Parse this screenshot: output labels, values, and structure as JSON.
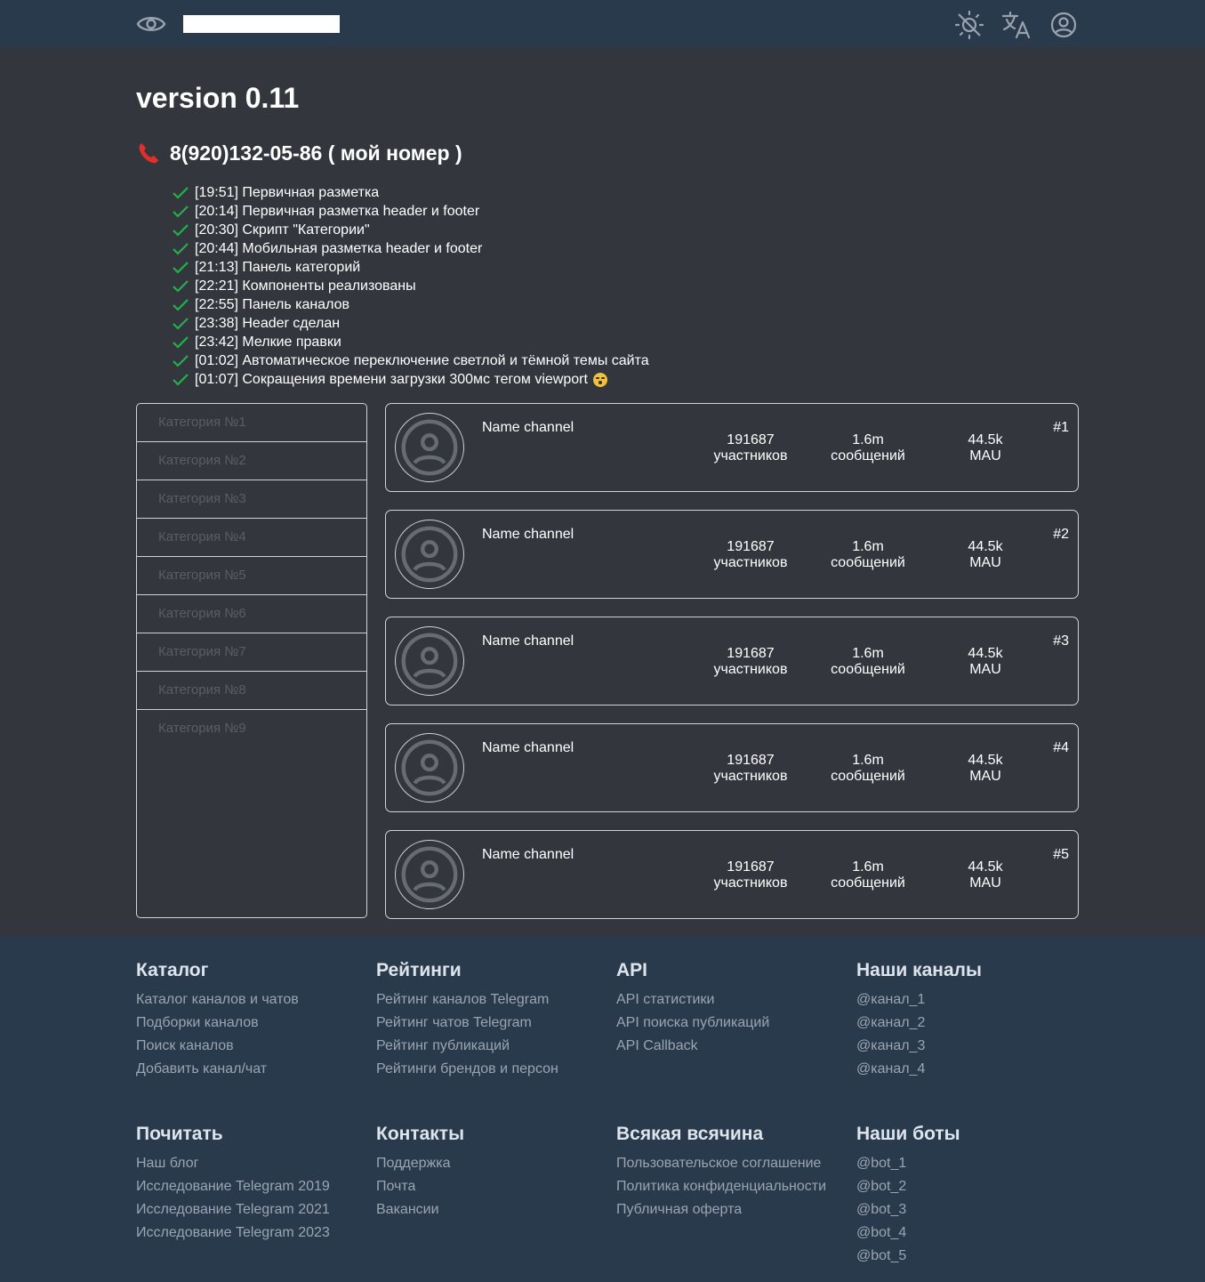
{
  "header": {
    "search_value": "",
    "icons": [
      "eye-icon",
      "theme-toggle-icon",
      "translate-icon",
      "account-icon"
    ]
  },
  "main": {
    "version": "version 0.11",
    "phone": "8(920)132-05-86 ( мой номер )",
    "changelog": [
      "[19:51] Первичная разметка",
      "[20:14] Первичная разметка header и footer",
      "[20:30] Скрипт \"Категории\"",
      "[20:44] Мобильная разметка header и footer",
      "[21:13] Панель категорий",
      "[22:21] Компоненты реализованы",
      "[22:55] Панель каналов",
      "[23:38] Header сделан",
      "[23:42] Мелкие правки",
      "[01:02] Автоматическое переключение светлой и тёмной темы сайта",
      "[01:07] Сокращения времени загрузки 300мс тегом viewport"
    ]
  },
  "categories": [
    "Категория №1",
    "Категория №2",
    "Категория №3",
    "Категория №4",
    "Категория №5",
    "Категория №6",
    "Категория №7",
    "Категория №8",
    "Категория №9"
  ],
  "channels": [
    {
      "name": "Name channel",
      "members": "191687",
      "members_label": "участников",
      "messages": "1.6m",
      "messages_label": "сообщений",
      "mau": "44.5k",
      "mau_label": "MAU",
      "rank": "#1"
    },
    {
      "name": "Name channel",
      "members": "191687",
      "members_label": "участников",
      "messages": "1.6m",
      "messages_label": "сообщений",
      "mau": "44.5k",
      "mau_label": "MAU",
      "rank": "#2"
    },
    {
      "name": "Name channel",
      "members": "191687",
      "members_label": "участников",
      "messages": "1.6m",
      "messages_label": "сообщений",
      "mau": "44.5k",
      "mau_label": "MAU",
      "rank": "#3"
    },
    {
      "name": "Name channel",
      "members": "191687",
      "members_label": "участников",
      "messages": "1.6m",
      "messages_label": "сообщений",
      "mau": "44.5k",
      "mau_label": "MAU",
      "rank": "#4"
    },
    {
      "name": "Name channel",
      "members": "191687",
      "members_label": "участников",
      "messages": "1.6m",
      "messages_label": "сообщений",
      "mau": "44.5k",
      "mau_label": "MAU",
      "rank": "#5"
    }
  ],
  "footer": {
    "columns": [
      {
        "title": "Каталог",
        "links": [
          "Каталог каналов и чатов",
          "Подборки каналов",
          "Поиск каналов",
          "Добавить канал/чат"
        ]
      },
      {
        "title": "Рейтинги",
        "links": [
          "Рейтинг каналов Telegram",
          "Рейтинг чатов Telegram",
          "Рейтинг публикаций",
          "Рейтинги брендов и персон"
        ]
      },
      {
        "title": "API",
        "links": [
          "API статистики",
          "API поиска публикаций",
          "API Callback"
        ]
      },
      {
        "title": "Наши каналы",
        "links": [
          "@канал_1",
          "@канал_2",
          "@канал_3",
          "@канал_4"
        ]
      },
      {
        "title": "Почитать",
        "links": [
          "Наш блог",
          "Исследование Telegram 2019",
          "Исследование Telegram 2021",
          "Исследование Telegram 2023"
        ]
      },
      {
        "title": "Контакты",
        "links": [
          "Поддержка",
          "Почта",
          "Вакансии"
        ]
      },
      {
        "title": "Всякая всячина",
        "links": [
          "Пользовательское соглашение",
          "Политика конфиденциальности",
          "Публичная оферта"
        ]
      },
      {
        "title": "Наши боты",
        "links": [
          "@bot_1",
          "@bot_2",
          "@bot_3",
          "@bot_4",
          "@bot_5"
        ]
      }
    ]
  }
}
